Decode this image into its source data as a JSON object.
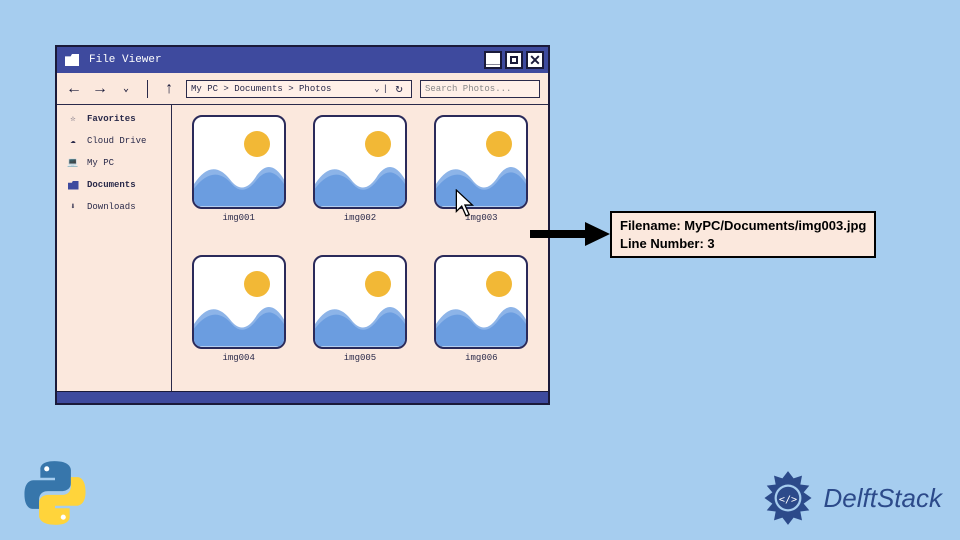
{
  "window": {
    "title": "File Viewer"
  },
  "toolbar": {
    "path": "My PC > Documents > Photos",
    "search_placeholder": "Search Photos..."
  },
  "sidebar": {
    "items": [
      {
        "label": "Favorites",
        "icon": "star-icon",
        "bold": true
      },
      {
        "label": "Cloud Drive",
        "icon": "cloud-icon",
        "bold": false
      },
      {
        "label": "My PC",
        "icon": "laptop-icon",
        "bold": false
      },
      {
        "label": "Documents",
        "icon": "folder-icon",
        "bold": true
      },
      {
        "label": "Downloads",
        "icon": "download-icon",
        "bold": false
      }
    ]
  },
  "files": [
    {
      "name": "img001"
    },
    {
      "name": "img002"
    },
    {
      "name": "img003"
    },
    {
      "name": "img004"
    },
    {
      "name": "img005"
    },
    {
      "name": "img006"
    }
  ],
  "callout": {
    "line1": "Filename: MyPC/Documents/img003.jpg",
    "line2": "Line Number: 3"
  },
  "brand": {
    "text": "DelftStack"
  }
}
